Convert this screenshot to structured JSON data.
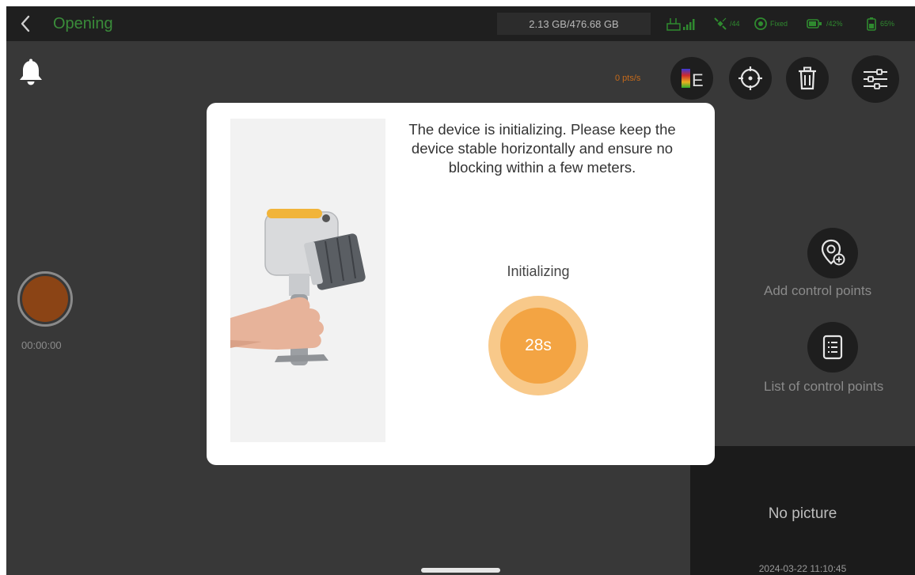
{
  "header": {
    "title": "Opening",
    "storage": "2.13 GB/476.68 GB",
    "status": {
      "network": {
        "icon": "network-signal-icon"
      },
      "satellites": {
        "icon": "satellite-icon",
        "value": "/44"
      },
      "fix": {
        "icon": "gnss-fix-icon",
        "label": "Fixed"
      },
      "device_battery": {
        "icon": "device-battery-icon",
        "value": "/42%"
      },
      "battery": {
        "icon": "battery-icon",
        "value": "65%"
      }
    }
  },
  "toolbar": {
    "point_rate": "0 pts/s",
    "buttons": [
      {
        "name": "color-mode-button",
        "icon": "color-mode-icon",
        "letter": "E"
      },
      {
        "name": "locate-button",
        "icon": "crosshair-icon"
      },
      {
        "name": "delete-button",
        "icon": "trash-icon"
      },
      {
        "name": "settings-button",
        "icon": "sliders-icon"
      }
    ]
  },
  "recording": {
    "timer": "00:00:00"
  },
  "side_actions": {
    "add_control_points": "Add control points",
    "list_control_points": "List of control points"
  },
  "preview": {
    "no_picture": "No picture",
    "timestamp": "2024-03-22 11:10:45"
  },
  "dialog": {
    "message": "The device is initializing. Please keep the device stable horizontally and ensure no blocking within a few meters.",
    "status_label": "Initializing",
    "countdown": "28s"
  },
  "colors": {
    "background": "#383838",
    "topbar": "#1f1f1f",
    "accent_green": "#3a8c3a",
    "record_red": "#8b4415",
    "countdown_orange": "#f3a443",
    "countdown_ring": "#f8c98a"
  }
}
